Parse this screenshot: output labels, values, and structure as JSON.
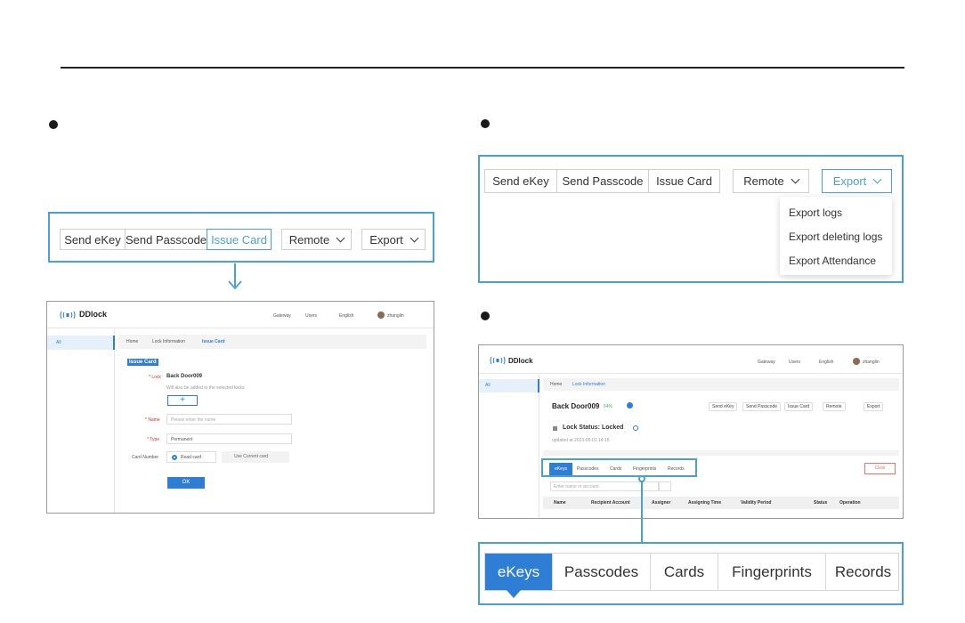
{
  "toolbar_buttons": [
    "Send eKey",
    "Send Passcode",
    "Issue Card"
  ],
  "remote_label": "Remote",
  "export_label": "Export",
  "export_menu": [
    "Export logs",
    "Export deleting logs",
    "Export Attendance"
  ],
  "app": {
    "brand": "DDlock",
    "nav": [
      "Gateway",
      "Users",
      "English"
    ],
    "user": "zhanglin",
    "sidebar_all": "All"
  },
  "issue_card": {
    "breadcrumb": [
      "Home",
      "Lock Information",
      "Issue Card"
    ],
    "title": "Issue Card",
    "lock_label": "* Lock",
    "lock_value": "Back Door009",
    "lock_note": "Will also be added to the selected locks",
    "name_label": "* Name",
    "name_placeholder": "Please enter the name",
    "type_label": "* Type",
    "type_value": "Permanent",
    "card_number_label": "Card Number",
    "read_card": "Read card",
    "use_current": "Use Current card",
    "ok": "OK"
  },
  "lock_info": {
    "breadcrumb": [
      "Home",
      "Lock Information"
    ],
    "lock_name": "Back Door009",
    "battery": "64%",
    "actions": [
      "Send eKey",
      "Send Passcode",
      "Issue Card",
      "Remote",
      "Export"
    ],
    "status": "Lock Status: Locked",
    "updated": "updated at 2023-05-01 14:15",
    "tabs": [
      "eKeys",
      "Passcodes",
      "Cards",
      "Fingerprints",
      "Records"
    ],
    "clear": "Clear",
    "search_placeholder": "Enter name or account",
    "columns": [
      "Name",
      "Recipient Account",
      "Assigner",
      "Assigning Time",
      "Validity Period",
      "Status",
      "Operation"
    ]
  },
  "big_tabs": [
    "eKeys",
    "Passcodes",
    "Cards",
    "Fingerprints",
    "Records"
  ],
  "colors": {
    "accent": "#4a9fd8",
    "tab_active": "#2e7ed6"
  }
}
